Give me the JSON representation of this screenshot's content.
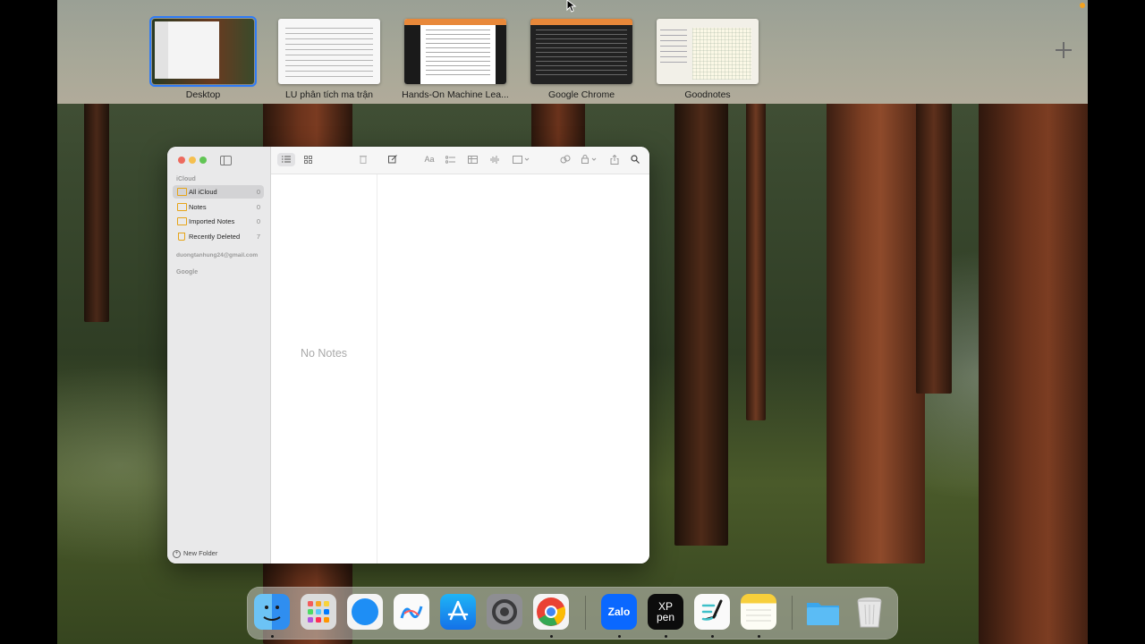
{
  "spaces": [
    {
      "label": "Desktop",
      "selected": true
    },
    {
      "label": "LU phân tích ma trận",
      "selected": false
    },
    {
      "label": "Hands-On Machine Lea...",
      "selected": false
    },
    {
      "label": "Google Chrome",
      "selected": false
    },
    {
      "label": "Goodnotes",
      "selected": false
    }
  ],
  "add_space_icon": "plus-icon",
  "notes": {
    "sidebar": {
      "icloud_title": "iCloud",
      "folders": [
        {
          "name": "All iCloud",
          "count": "0",
          "icon": "folder-icon",
          "selected": true
        },
        {
          "name": "Notes",
          "count": "0",
          "icon": "folder-icon",
          "selected": false
        },
        {
          "name": "Imported Notes",
          "count": "0",
          "icon": "folder-icon",
          "selected": false
        },
        {
          "name": "Recently Deleted",
          "count": "7",
          "icon": "trash-icon",
          "selected": false
        }
      ],
      "gmail_account": "duongtanhung24@gmail.com",
      "google_title": "Google",
      "new_folder_label": "New Folder"
    },
    "toolbar": {
      "format_label": "Aa"
    },
    "list": {
      "empty_text": "No Notes"
    }
  },
  "dock": {
    "apps": [
      "Finder",
      "Launchpad",
      "Safari",
      "Freeform",
      "App Store",
      "System Settings",
      "Google Chrome",
      "Zalo",
      "XPPen",
      "Goodnotes",
      "Notes",
      "Downloads",
      "Trash"
    ],
    "zalo_text": "Zalo",
    "xppen_text_top": "XP",
    "xppen_text_bottom": "pen"
  },
  "colors": {
    "accent": "#2f7bf5",
    "folder": "#e6a418",
    "close": "#ed6a5e",
    "minimize": "#f5bf4f",
    "maximize": "#61c554"
  }
}
